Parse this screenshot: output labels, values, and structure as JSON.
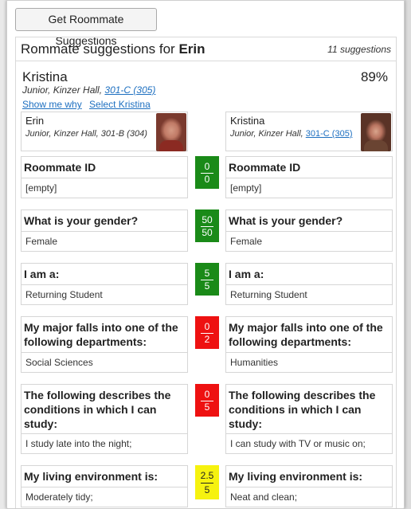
{
  "button": {
    "label": "Get Roommate Suggestions"
  },
  "panel": {
    "title_prefix": "Rommate suggestions for",
    "title_name": "Erin",
    "suggestion_count": "11 suggestions"
  },
  "candidate": {
    "name": "Kristina",
    "match_percent": "89%",
    "class_hall": "Junior, Kinzer Hall,",
    "room_link": "301-C (305)",
    "show_why": "Show me why",
    "select": "Select Kristina"
  },
  "person_a": {
    "name": "Erin",
    "details": "Junior, Kinzer Hall, 301-B (304)"
  },
  "person_b": {
    "name": "Kristina",
    "details": "Junior, Kinzer Hall,",
    "room_link": "301-C (305)"
  },
  "questions": [
    {
      "question": "Roommate ID",
      "answer_a": "[empty]",
      "answer_b": "[empty]",
      "score_num": "0",
      "score_den": "0",
      "score_color": "#1a8a18"
    },
    {
      "question": "What is your gender?",
      "answer_a": "Female",
      "answer_b": "Female",
      "score_num": "50",
      "score_den": "50",
      "score_color": "#1a8a18"
    },
    {
      "question": "I am a:",
      "answer_a": "Returning Student",
      "answer_b": "Returning Student",
      "score_num": "5",
      "score_den": "5",
      "score_color": "#1a8a18"
    },
    {
      "question": "My major falls into one of the following departments:",
      "answer_a": "Social Sciences",
      "answer_b": "Humanities",
      "score_num": "0",
      "score_den": "2",
      "score_color": "#ee1111"
    },
    {
      "question": "The following describes the conditions in which I can study:",
      "answer_a": "I study late into the night;",
      "answer_b": "I can study with TV or music on;",
      "score_num": "0",
      "score_den": "5",
      "score_color": "#ee1111"
    },
    {
      "question": "My living environment is:",
      "answer_a": "Moderately tidy;",
      "answer_b": "Neat and clean;",
      "score_num": "2.5",
      "score_den": "5",
      "score_color": "#f6f20f"
    }
  ]
}
